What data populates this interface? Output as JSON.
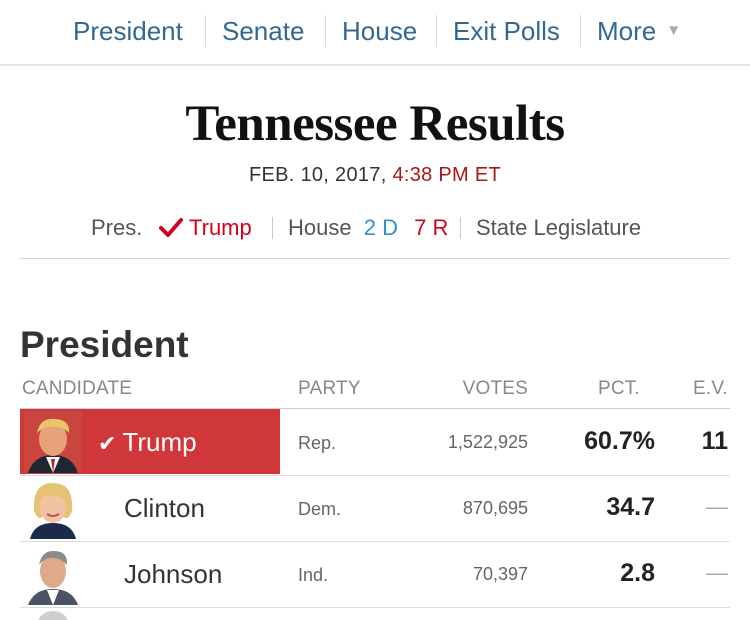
{
  "nav": {
    "items": [
      "President",
      "Senate",
      "House",
      "Exit Polls",
      "More"
    ],
    "more_caret": "▼"
  },
  "page": {
    "title": "Tennessee Results",
    "date": "FEB. 10, 2017,",
    "time": "4:38 PM ET"
  },
  "summary": {
    "pres_label": "Pres.",
    "pres_winner": "Trump",
    "house_label": "House",
    "house_dem": "2 D",
    "house_rep": "7 R",
    "legislature_label": "State Legislature"
  },
  "results": {
    "section_title": "President",
    "headers": {
      "candidate": "CANDIDATE",
      "party": "PARTY",
      "votes": "VOTES",
      "pct": "PCT.",
      "ev": "E.V."
    },
    "rows": [
      {
        "name": "Trump",
        "party": "Rep.",
        "votes": "1,522,925",
        "pct": "60.7%",
        "ev": "11",
        "winner": true
      },
      {
        "name": "Clinton",
        "party": "Dem.",
        "votes": "870,695",
        "pct": "34.7",
        "ev": "—",
        "winner": false
      },
      {
        "name": "Johnson",
        "party": "Ind.",
        "votes": "70,397",
        "pct": "2.8",
        "ev": "—",
        "winner": false
      }
    ]
  },
  "colors": {
    "nav_link": "#326891",
    "winner_fill": "#d0373b",
    "republican": "#d0021b",
    "democrat": "#2f8fce",
    "timestamp_time": "#a81817"
  },
  "icons": {
    "winner": "checkmark-icon",
    "more": "caret-down-icon"
  }
}
